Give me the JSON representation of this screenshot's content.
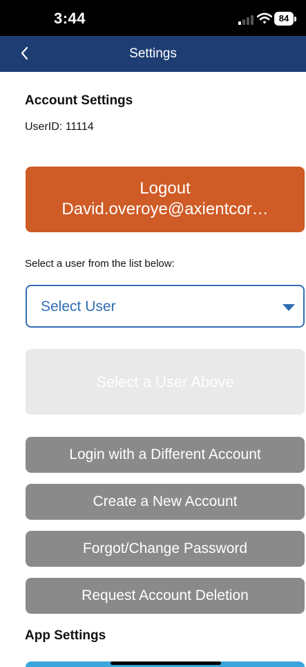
{
  "status_bar": {
    "time": "3:44",
    "battery": "84"
  },
  "nav": {
    "title": "Settings",
    "back_icon": "chevron-left-icon"
  },
  "account_settings": {
    "title": "Account Settings",
    "user_id_label": "UserID:",
    "user_id_value": "11114",
    "logout_label": "Logout",
    "logout_email": "David.overoye@axientcor…",
    "select_prompt": "Select a user from the list below:",
    "select_user_value": "Select User",
    "select_above_label": "Select a User Above",
    "buttons": [
      {
        "label": "Login with a Different Account"
      },
      {
        "label": "Create a New Account"
      },
      {
        "label": "Forgot/Change Password"
      },
      {
        "label": "Request Account Deletion"
      }
    ]
  },
  "app_settings": {
    "title": "App Settings"
  },
  "colors": {
    "nav_background": "#1e3e73",
    "logout_orange": "#cf5b26",
    "select_blue": "#2f6db3",
    "gray_button": "#8a8a8a",
    "disabled_button": "#e9e9e9",
    "bottom_button_blue": "#3aa6dc"
  }
}
